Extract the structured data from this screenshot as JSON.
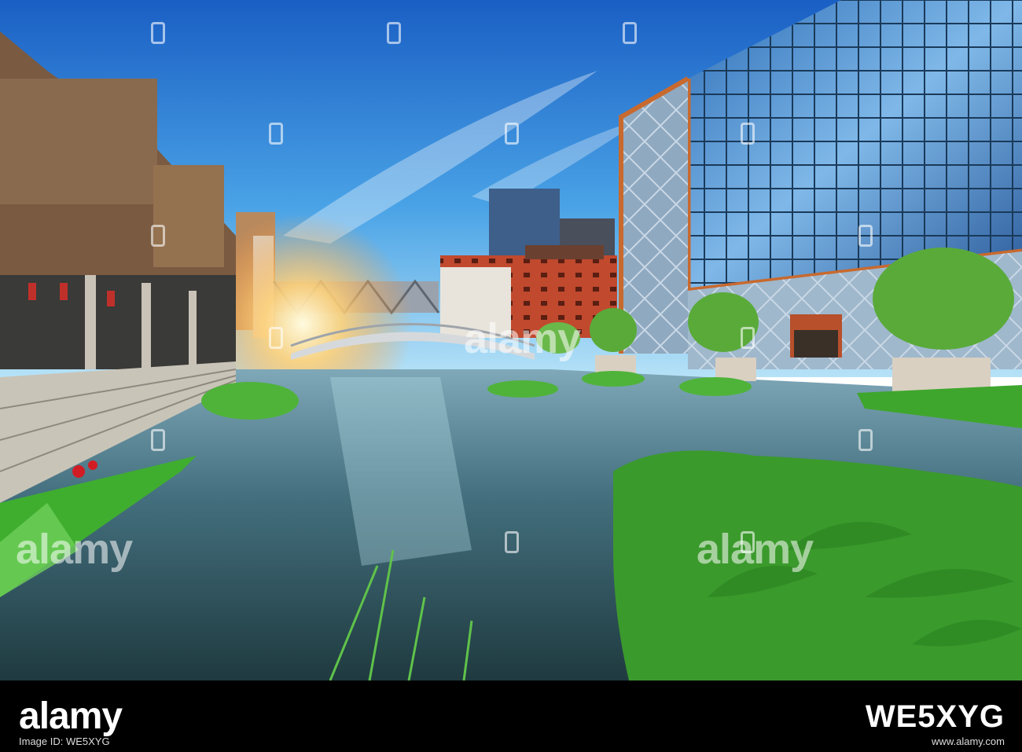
{
  "photo": {
    "description_name": "canal-waterfront-scene",
    "colors": {
      "sky_top": "#1f6fd0",
      "sky_bottom": "#8fd2f5",
      "sun": "#ffd27a",
      "water": "#2f4a56",
      "grass": "#3fae2f",
      "brick": "#c0492e",
      "glass": "#4f8fd0",
      "wood": "#8a6a4e"
    }
  },
  "watermark": {
    "text": "alamy"
  },
  "footer": {
    "logo": "alamy",
    "image_id_label": "Image ID: WE5XYG",
    "site": "www.alamy.com",
    "code": "WE5XYG"
  }
}
